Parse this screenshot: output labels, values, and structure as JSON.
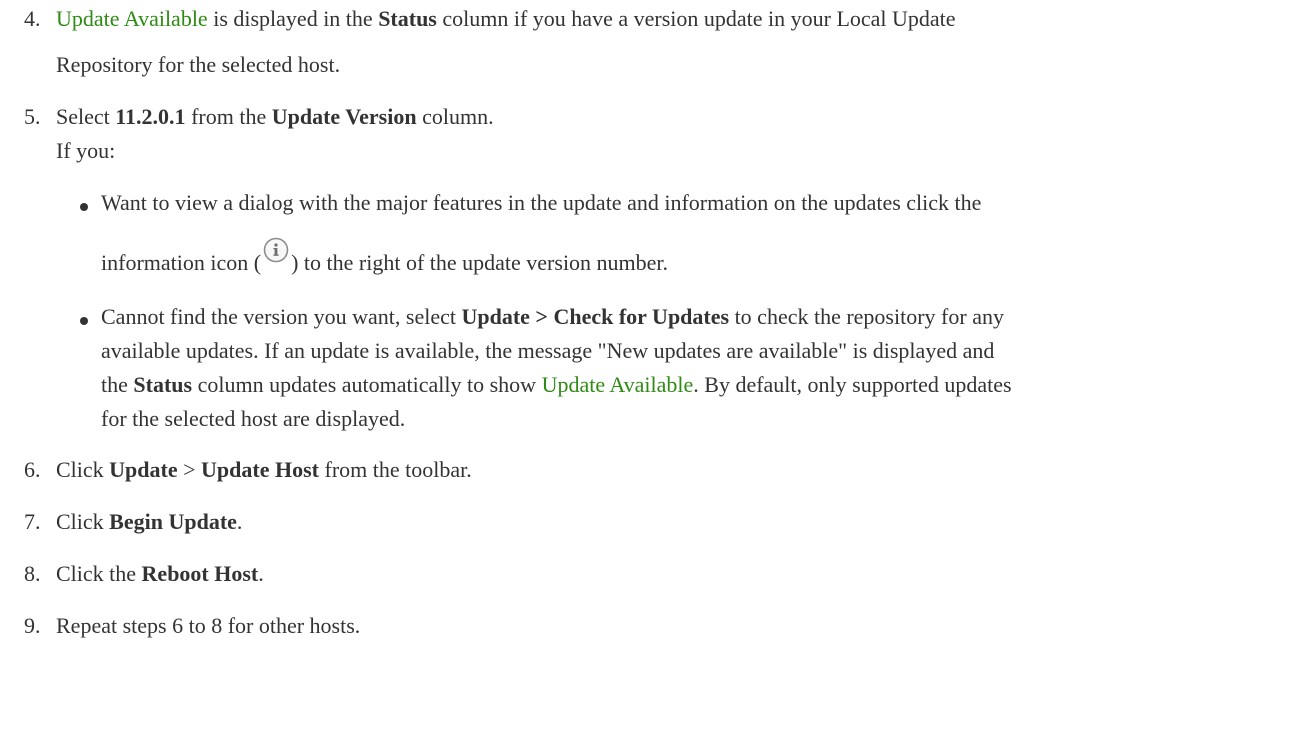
{
  "steps": {
    "s4": {
      "num": "4.",
      "l1_link": "Update Available",
      "l1_a": " is displayed in the ",
      "l1_b": "Status",
      "l1_c": " column if you have a version update in your Local Update",
      "l2": "Repository for the selected host."
    },
    "s5": {
      "num": "5.",
      "l1_a": " Select ",
      "l1_b": "11.2.0.1",
      "l1_c": " from the ",
      "l1_d": "Update Version",
      "l1_e": " column.",
      "l2": "If you:",
      "bullet1": {
        "l1": "Want to view a dialog with the major features in the update and information on the updates click the",
        "l2_a": "information icon (",
        "l2_b": ") to the right of the update version number."
      },
      "bullet2": {
        "l1_a": "Cannot find the version you want, select ",
        "l1_b": "Update > Check for Updates",
        "l1_c": " to check the repository for any",
        "l2": "available updates. If an update is available, the message \"New updates are available\" is displayed and",
        "l3_a": "the ",
        "l3_b": "Status",
        "l3_c": " column updates automatically to show ",
        "l3_link": "Update Available",
        "l3_d": ". By default, only supported updates",
        "l4": "for the selected host are displayed."
      }
    },
    "s6": {
      "num": "6.",
      "a": "Click ",
      "b": "Update",
      "c": " > ",
      "d": "Update Host",
      "e": " from the toolbar."
    },
    "s7": {
      "num": "7.",
      "a": "Click ",
      "b": "Begin Update",
      "c": "."
    },
    "s8": {
      "num": "8.",
      "a": "Click the ",
      "b": "Reboot Host",
      "c": "."
    },
    "s9": {
      "num": "9.",
      "a": "Repeat steps 6 to 8 for other hosts."
    }
  },
  "icons": {
    "info": "info-circle-icon"
  },
  "colors": {
    "link": "#2e8b14",
    "text": "#333333"
  }
}
